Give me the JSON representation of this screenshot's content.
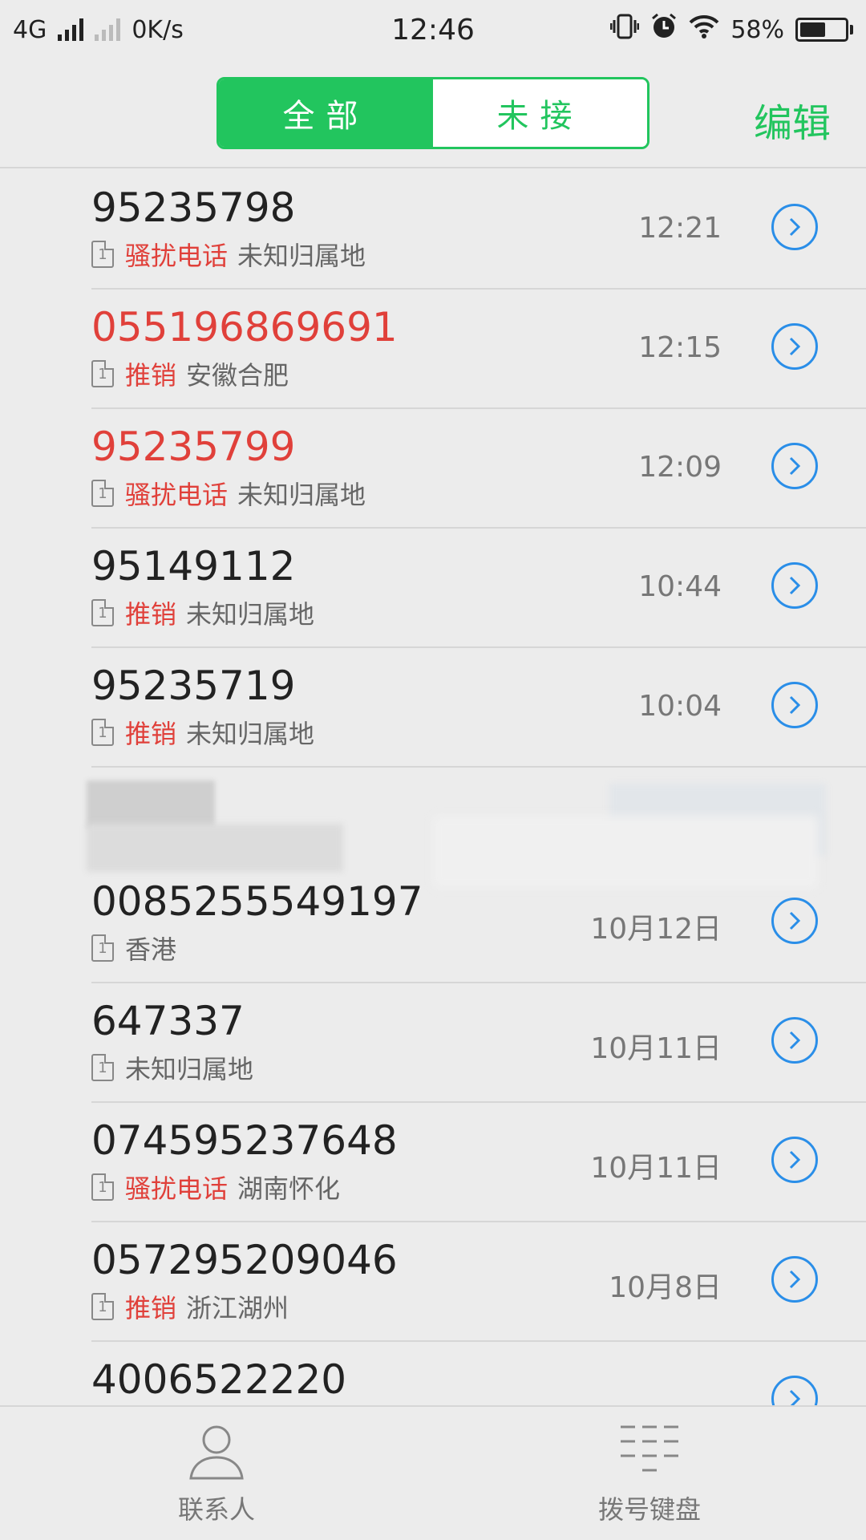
{
  "status_bar": {
    "network": "4G",
    "speed": "0K/s",
    "time": "12:46",
    "battery_percent": "58%",
    "battery_level": 0.58
  },
  "header": {
    "tabs": [
      {
        "label": "全部",
        "active": true
      },
      {
        "label": "未接",
        "active": false
      }
    ],
    "edit_label": "编辑"
  },
  "calls": [
    {
      "number": "95235798",
      "missed": false,
      "tag": "骚扰电话",
      "location": "未知归属地",
      "time": "12:21"
    },
    {
      "number": "055196869691",
      "missed": true,
      "tag": "推销",
      "location": "安徽合肥",
      "time": "12:15"
    },
    {
      "number": "95235799",
      "missed": true,
      "tag": "骚扰电话",
      "location": "未知归属地",
      "time": "12:09"
    },
    {
      "number": "95149112",
      "missed": false,
      "tag": "推销",
      "location": "未知归属地",
      "time": "10:44"
    },
    {
      "number": "95235719",
      "missed": false,
      "tag": "推销",
      "location": "未知归属地",
      "time": "10:04"
    }
  ],
  "calls_after_blur": [
    {
      "number": "0085255549197",
      "missed": false,
      "tag": "",
      "location": "香港",
      "time": "10月12日"
    },
    {
      "number": "647337",
      "missed": false,
      "tag": "",
      "location": "未知归属地",
      "time": "10月11日"
    },
    {
      "number": "074595237648",
      "missed": false,
      "tag": "骚扰电话",
      "location": "湖南怀化",
      "time": "10月11日"
    },
    {
      "number": "057295209046",
      "missed": false,
      "tag": "推销",
      "location": "浙江湖州",
      "time": "10月8日"
    },
    {
      "number": "4006522220",
      "missed": false,
      "tag": "",
      "location": "",
      "time": ""
    }
  ],
  "tabbar": {
    "contacts_label": "联系人",
    "dialpad_label": "拨号键盘"
  },
  "colors": {
    "accent_green": "#22c55e",
    "missed_red": "#e0403a",
    "info_blue": "#2a8ee8"
  }
}
